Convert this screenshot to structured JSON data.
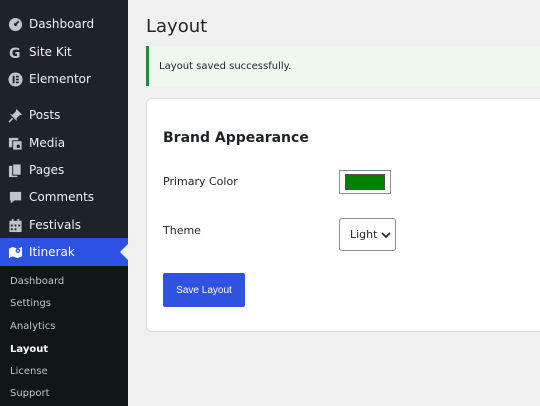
{
  "sidebar": {
    "items": [
      {
        "label": "Dashboard",
        "icon": "dashboard-icon"
      },
      {
        "label": "Site Kit",
        "icon": "site-kit-icon"
      },
      {
        "label": "Elementor",
        "icon": "elementor-icon"
      },
      {
        "label": "Posts",
        "icon": "pin-icon"
      },
      {
        "label": "Media",
        "icon": "media-icon"
      },
      {
        "label": "Pages",
        "icon": "pages-icon"
      },
      {
        "label": "Comments",
        "icon": "comment-icon"
      },
      {
        "label": "Festivals",
        "icon": "calendar-icon"
      },
      {
        "label": "Itinerak",
        "icon": "map-icon",
        "active": true
      }
    ],
    "submenu": [
      "Dashboard",
      "Settings",
      "Analytics",
      "Layout",
      "License",
      "Support"
    ],
    "current_submenu": "Layout",
    "active_color": "#2b52e0"
  },
  "page": {
    "title": "Layout",
    "notice": "Layout saved successfully."
  },
  "card": {
    "title": "Brand Appearance",
    "primary_color_label": "Primary Color",
    "primary_color_value": "#008000",
    "theme_label": "Theme",
    "theme_value": "Light",
    "save_label": "Save Layout"
  }
}
